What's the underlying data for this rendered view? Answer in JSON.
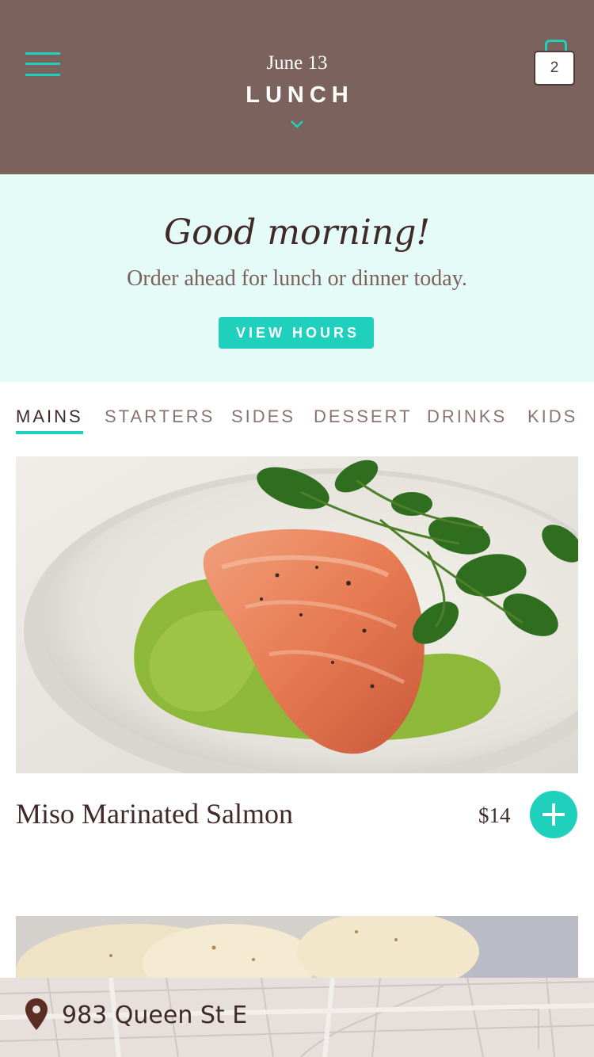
{
  "header": {
    "date": "June 13",
    "meal": "LUNCH",
    "cart_count": "2"
  },
  "banner": {
    "greeting": "Good morning!",
    "subtitle": "Order ahead for lunch or dinner today.",
    "view_hours_label": "VIEW HOURS"
  },
  "tabs": [
    {
      "label": "MAINS",
      "active": true
    },
    {
      "label": "STARTERS"
    },
    {
      "label": "SIDES"
    },
    {
      "label": "DESSERT"
    },
    {
      "label": "DRINKS"
    },
    {
      "label": "KIDS"
    }
  ],
  "items": [
    {
      "name": "Miso Marinated Salmon",
      "price": "$14"
    }
  ],
  "location": {
    "address": "983 Queen St E"
  },
  "colors": {
    "header_bg": "#7b625c",
    "accent": "#1fd0bd",
    "banner_bg": "#e4fbf8",
    "text_dark": "#3f2a27"
  }
}
